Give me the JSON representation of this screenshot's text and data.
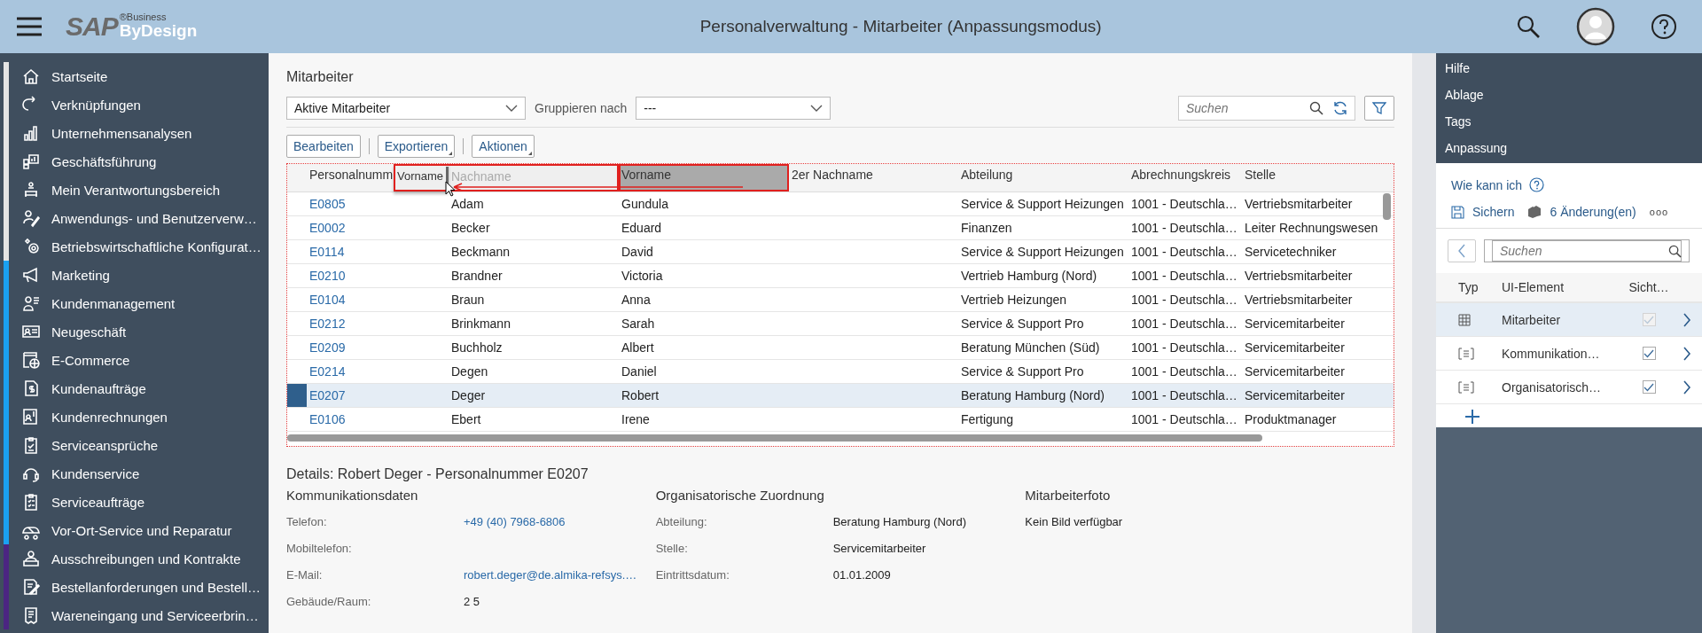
{
  "header": {
    "logo": {
      "brand": "SAP",
      "superscript": "®Business",
      "product": "ByDesign"
    },
    "title": "Personalverwaltung - Mitarbeiter (Anpassungsmodus)"
  },
  "sidebar": {
    "items": [
      {
        "label": "Startseite",
        "color": "#e4e4e4"
      },
      {
        "label": "Verknüpfungen",
        "color": "#e4e4e4"
      },
      {
        "label": "Unternehmensanalysen",
        "color": "#e4e4e4"
      },
      {
        "label": "Geschäftsführung",
        "color": "#e4e4e4"
      },
      {
        "label": "Mein Verantwortungsbereich",
        "color": "#e4e4e4"
      },
      {
        "label": "Anwendungs- und Benutzerverw…",
        "color": "#e4e4e4"
      },
      {
        "label": "Betriebswirtschaftliche Konfigurat…",
        "color": "#e4e4e4"
      },
      {
        "label": "Marketing",
        "color": "#1aa1f2"
      },
      {
        "label": "Kundenmanagement",
        "color": "#1aa1f2"
      },
      {
        "label": "Neugeschäft",
        "color": "#1aa1f2"
      },
      {
        "label": "E-Commerce",
        "color": "#1aa1f2"
      },
      {
        "label": "Kundenaufträge",
        "color": "#1aa1f2"
      },
      {
        "label": "Kundenrechnungen",
        "color": "#1aa1f2"
      },
      {
        "label": "Serviceansprüche",
        "color": "#1aa1f2"
      },
      {
        "label": "Kundenservice",
        "color": "#1aa1f2"
      },
      {
        "label": "Serviceaufträge",
        "color": "#1aa1f2"
      },
      {
        "label": "Vor-Ort-Service und Reparatur",
        "color": "#1aa1f2"
      },
      {
        "label": "Ausschreibungen und Kontrakte",
        "color": "#4b2582"
      },
      {
        "label": "Bestellanforderungen und Bestell…",
        "color": "#4b2582"
      },
      {
        "label": "Wareneingang und Serviceerbrin…",
        "color": "#4b2582"
      }
    ]
  },
  "main": {
    "title": "Mitarbeiter",
    "filter": {
      "value": "Aktive Mitarbeiter"
    },
    "group_label": "Gruppieren nach",
    "group": {
      "value": "---"
    },
    "search": {
      "placeholder": "Suchen"
    },
    "actions": [
      "Bearbeiten",
      "Exportieren",
      "Aktionen"
    ],
    "table": {
      "columns": [
        {
          "label": "Personalnumm",
          "dimmed": false,
          "dragged": false
        },
        {
          "label": "Nachname",
          "dimmed": true,
          "dragged": false
        },
        {
          "label": "Vorname",
          "dimmed": false,
          "dragged": true
        },
        {
          "label": "2er Nachname",
          "dimmed": false,
          "dragged": false
        },
        {
          "label": "Abteilung",
          "dimmed": false,
          "dragged": false
        },
        {
          "label": "Abrechnungskreis",
          "dimmed": false,
          "dragged": false
        },
        {
          "label": "Stelle",
          "dimmed": false,
          "dragged": false
        }
      ],
      "drag_ghost": {
        "label": "Vorname"
      },
      "rows": [
        {
          "selected": false,
          "cells": [
            "E0805",
            "Adam",
            "Gundula",
            null,
            "Service & Support Heizungen",
            "1001 - Deutschla…",
            "Vertriebsmitarbeiter"
          ]
        },
        {
          "selected": false,
          "cells": [
            "E0002",
            "Becker",
            "Eduard",
            null,
            "Finanzen",
            "1001 - Deutschla…",
            "Leiter Rechnungswesen"
          ]
        },
        {
          "selected": false,
          "cells": [
            "E0114",
            "Beckmann",
            "David",
            null,
            "Service & Support Heizungen",
            "1001 - Deutschla…",
            "Servicetechniker"
          ]
        },
        {
          "selected": false,
          "cells": [
            "E0210",
            "Brandner",
            "Victoria",
            null,
            "Vertrieb Hamburg (Nord)",
            "1001 - Deutschla…",
            "Vertriebsmitarbeiter"
          ]
        },
        {
          "selected": false,
          "cells": [
            "E0104",
            "Braun",
            "Anna",
            null,
            "Vertrieb Heizungen",
            "1001 - Deutschla…",
            "Vertriebsmitarbeiter"
          ]
        },
        {
          "selected": false,
          "cells": [
            "E0212",
            "Brinkmann",
            "Sarah",
            null,
            "Service & Support Pro",
            "1001 - Deutschla…",
            "Servicemitarbeiter"
          ]
        },
        {
          "selected": false,
          "cells": [
            "E0209",
            "Buchholz",
            "Albert",
            null,
            "Beratung München (Süd)",
            "1001 - Deutschla…",
            "Servicemitarbeiter"
          ]
        },
        {
          "selected": false,
          "cells": [
            "E0214",
            "Degen",
            "Daniel",
            null,
            "Service & Support Pro",
            "1001 - Deutschla…",
            "Servicemitarbeiter"
          ]
        },
        {
          "selected": true,
          "cells": [
            "E0207",
            "Deger",
            "Robert",
            null,
            "Beratung Hamburg (Nord)",
            "1001 - Deutschla…",
            "Servicemitarbeiter"
          ]
        },
        {
          "selected": false,
          "cells": [
            "E0106",
            "Ebert",
            "Irene",
            null,
            "Fertigung",
            "1001 - Deutschla…",
            "Produktmanager"
          ]
        }
      ]
    },
    "details": {
      "title": "Details: Robert Deger - Personalnummer E0207",
      "sections": [
        {
          "heading": "Kommunikationsdaten",
          "fields": [
            {
              "label": "Telefon:",
              "value": "+49 (40) 7968-6806",
              "kind": "link"
            },
            {
              "label": "Mobiltelefon:"
            },
            {
              "label": "E-Mail:",
              "value": "robert.deger@de.almika-refsys.…",
              "kind": "link"
            },
            {
              "label": "Gebäude/Raum:",
              "value": "2 5",
              "kind": "text"
            }
          ]
        },
        {
          "heading": "Organisatorische Zuordnung",
          "fields": [
            {
              "label": "Abteilung:",
              "value": "Beratung Hamburg (Nord)",
              "kind": "text"
            },
            {
              "label": "Stelle:",
              "value": "Servicemitarbeiter",
              "kind": "text"
            },
            {
              "label": "Eintrittsdatum:",
              "value": "01.01.2009",
              "kind": "text"
            }
          ]
        },
        {
          "heading": "Mitarbeiterfoto",
          "note": "Kein Bild verfügbar"
        }
      ]
    }
  },
  "side_panel": {
    "menu": [
      "Hilfe",
      "Ablage",
      "Tags",
      "Anpassung"
    ],
    "how_to": "Wie kann ich",
    "save": "Sichern",
    "changes": "6 Änderung(en)",
    "more": "ooo",
    "search": {
      "placeholder": "Suchen"
    },
    "columns": [
      "Typ",
      "UI-Element",
      "Sicht…"
    ],
    "rows": [
      {
        "kind": "table",
        "label": "Mitarbeiter",
        "checked": true,
        "disabled": true,
        "selected": true
      },
      {
        "kind": "form",
        "label": "Kommunikation…",
        "checked": true,
        "disabled": false,
        "selected": false
      },
      {
        "kind": "form",
        "label": "Organisatorisch…",
        "checked": true,
        "disabled": false,
        "selected": false
      }
    ]
  }
}
